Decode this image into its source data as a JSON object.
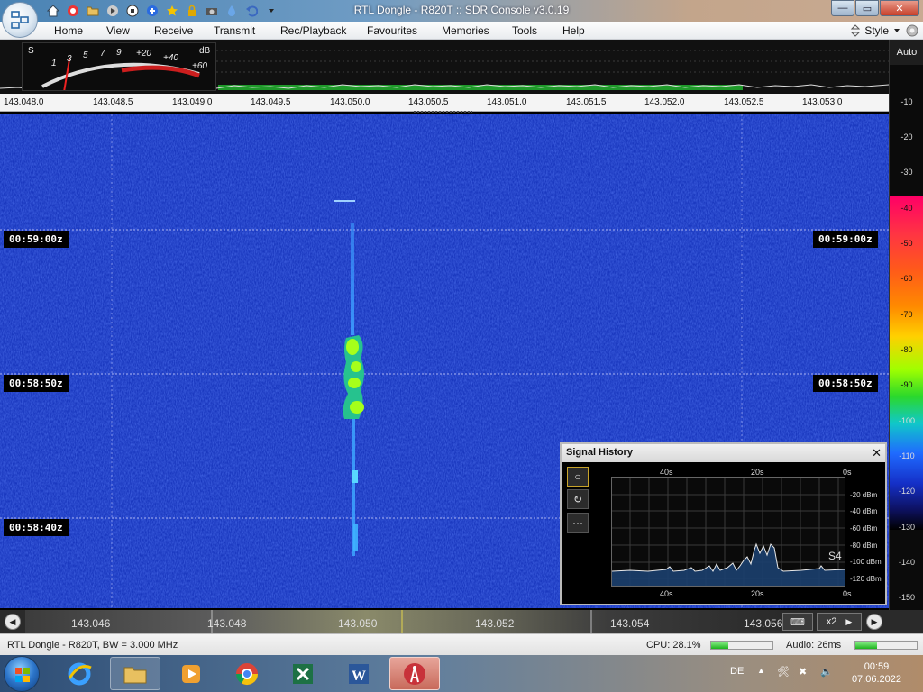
{
  "window": {
    "title": "RTL Dongle - R820T :: SDR Console v3.0.19",
    "controls": {
      "minimize": "—",
      "maximize": "▭",
      "close": "✕"
    }
  },
  "quick_access": [
    "home-icon",
    "lifebuoy-icon",
    "folder-icon",
    "play-icon",
    "stop-icon",
    "add-icon",
    "star-icon",
    "lock-icon",
    "camera-icon",
    "drop-icon",
    "undo-icon",
    "dropdown-icon"
  ],
  "menu": {
    "items": [
      "Home",
      "View",
      "Receive",
      "Transmit",
      "Rec/Playback",
      "Favourites",
      "Memories",
      "Tools",
      "Help"
    ],
    "style_label": "Style"
  },
  "smeter": {
    "s_label": "S",
    "db_label": "dB",
    "scale": [
      "1",
      "3",
      "5",
      "7",
      "9",
      "+20",
      "+40",
      "+60"
    ]
  },
  "top_frequency_scale": [
    "143.048.0",
    "143.048.5",
    "143.049.0",
    "143.049.5",
    "143.050.0",
    "143.050.5",
    "143.051.0",
    "143.051.5",
    "143.052.0",
    "143.052.5",
    "143.053.0"
  ],
  "db_scale": {
    "auto_label": "Auto",
    "labels": [
      "-10",
      "-20",
      "-30",
      "-40",
      "-50",
      "-60",
      "-70",
      "-80",
      "-90",
      "-100",
      "-110",
      "-120",
      "-130",
      "-140",
      "-150"
    ]
  },
  "waterfall": {
    "timestamps": [
      "00:59:00z",
      "00:58:50z",
      "00:58:40z"
    ],
    "signal_frequency_mhz": 143.05
  },
  "signal_history": {
    "title": "Signal History",
    "close": "✕",
    "buttons": [
      "○",
      "↻",
      "···"
    ],
    "time_ticks": [
      "40s",
      "20s",
      "0s"
    ],
    "y_labels": [
      "-20 dBm",
      "-40 dBm",
      "-60 dBm",
      "-80 dBm",
      "-100 dBm",
      "-120 dBm"
    ],
    "s_reading": "S4"
  },
  "tuning_bar": {
    "labels": [
      "143.046",
      "143.048",
      "143.050",
      "143.052",
      "143.054",
      "143.056"
    ],
    "zoom": "x2"
  },
  "status": {
    "device": "RTL Dongle - R820T, BW = 3.000 MHz",
    "cpu": "CPU: 28.1%",
    "cpu_fraction": 0.281,
    "audio": "Audio: 26ms",
    "audio_fraction": 0.35
  },
  "taskbar": {
    "language": "DE",
    "time": "00:59",
    "date": "07.06.2022",
    "apps": [
      "internet-explorer",
      "file-explorer",
      "media-player",
      "chrome",
      "excel",
      "word",
      "sdr-console"
    ]
  }
}
